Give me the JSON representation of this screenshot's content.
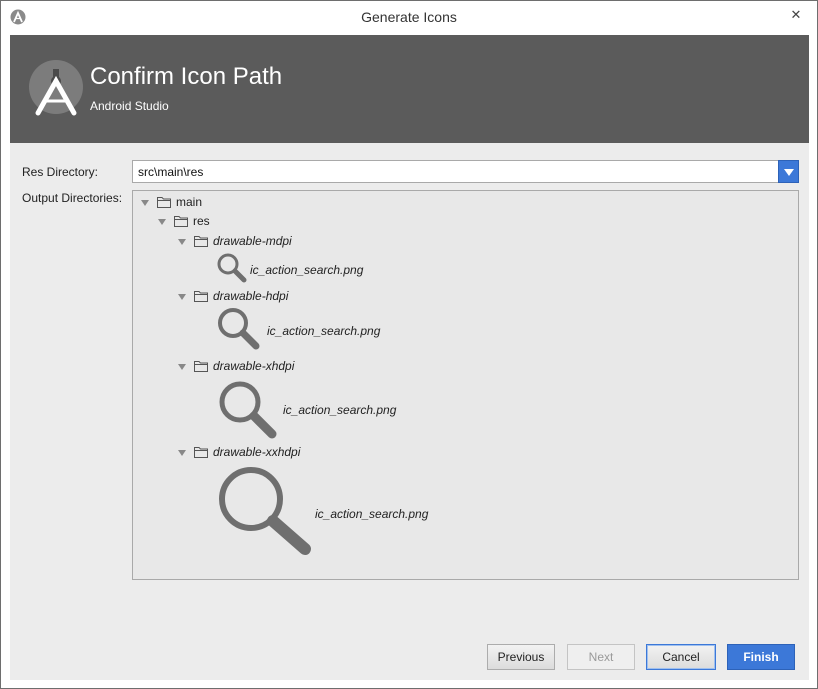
{
  "window": {
    "title": "Generate Icons",
    "close_glyph": "✕",
    "app_icon": "android-studio-icon"
  },
  "header": {
    "title": "Confirm Icon Path",
    "subtitle": "Android Studio",
    "logo": "android-studio-logo"
  },
  "form": {
    "res_directory_label": "Res Directory:",
    "res_directory_value": "src\\main\\res",
    "output_directories_label": "Output Directories:"
  },
  "tree": {
    "main": "main",
    "res": "res",
    "folders": [
      {
        "name": "drawable-mdpi",
        "file": "ic_action_search.png"
      },
      {
        "name": "drawable-hdpi",
        "file": "ic_action_search.png"
      },
      {
        "name": "drawable-xhdpi",
        "file": "ic_action_search.png"
      },
      {
        "name": "drawable-xxhdpi",
        "file": "ic_action_search.png"
      }
    ]
  },
  "buttons": {
    "previous": "Previous",
    "next": "Next",
    "cancel": "Cancel",
    "finish": "Finish"
  },
  "colors": {
    "header_bg": "#5b5b5b",
    "accent": "#3c78d8",
    "body_bg": "#ececec",
    "icon_gray": "#6f6f6f"
  }
}
